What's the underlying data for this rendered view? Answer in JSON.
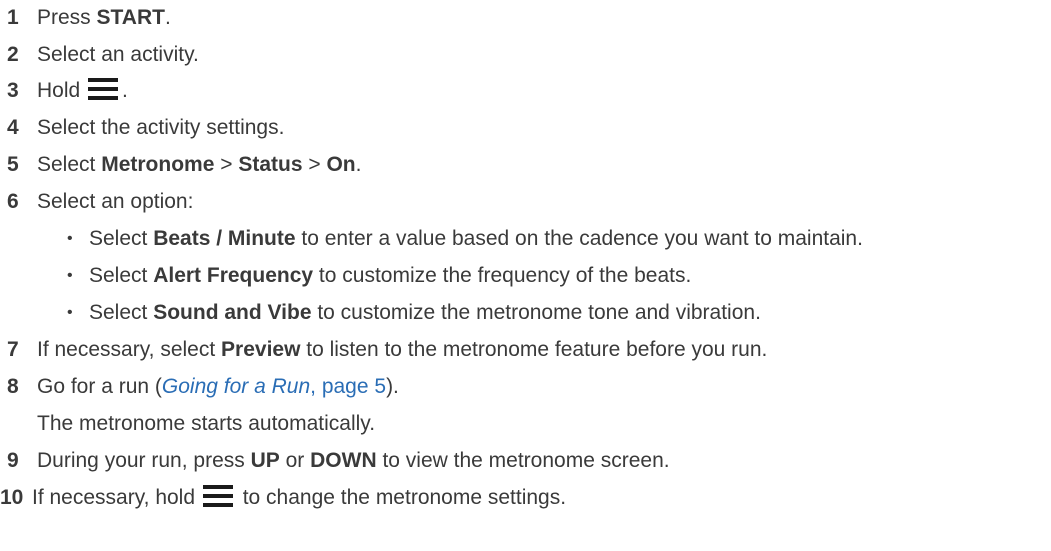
{
  "steps": {
    "s1": {
      "num": "1",
      "pre": "Press ",
      "bold": "START",
      "post": "."
    },
    "s2": {
      "num": "2",
      "text": "Select an activity."
    },
    "s3": {
      "num": "3",
      "pre": "Hold ",
      "icon": "menu-icon",
      "post": "."
    },
    "s4": {
      "num": "4",
      "text": "Select the activity settings."
    },
    "s5": {
      "num": "5",
      "pre": "Select ",
      "b1": "Metronome",
      "sep1": " > ",
      "b2": "Status",
      "sep2": " > ",
      "b3": "On",
      "post": "."
    },
    "s6": {
      "num": "6",
      "text": "Select an option:"
    },
    "s7": {
      "num": "7",
      "pre": "If necessary, select ",
      "bold": "Preview",
      "post": " to listen to the metronome feature before you run."
    },
    "s8": {
      "num": "8",
      "pre": "Go for a run (",
      "link_italic": "Going for a Run",
      "link_rest": ", page 5",
      "post": ")."
    },
    "s8_cont": "The metronome starts automatically.",
    "s9": {
      "num": "9",
      "pre": "During your run, press ",
      "b1": "UP",
      "mid": " or ",
      "b2": "DOWN",
      "post": " to view the metronome screen."
    },
    "s10": {
      "num": "10",
      "pre": "If necessary, hold ",
      "icon": "menu-icon",
      "post": " to change the metronome settings."
    }
  },
  "options": [
    {
      "bullet": "•",
      "pre": "Select ",
      "bold": "Beats / Minute",
      "post": " to enter a value based on the cadence you want to maintain."
    },
    {
      "bullet": "•",
      "pre": "Select ",
      "bold": "Alert Frequency",
      "post": " to customize the frequency of the beats."
    },
    {
      "bullet": "•",
      "pre": "Select ",
      "bold": "Sound and Vibe",
      "post": " to customize the metronome tone and vibration."
    }
  ],
  "colors": {
    "text": "#3a3a3a",
    "link": "#2a6db5",
    "icon": "#1a1a1a"
  }
}
